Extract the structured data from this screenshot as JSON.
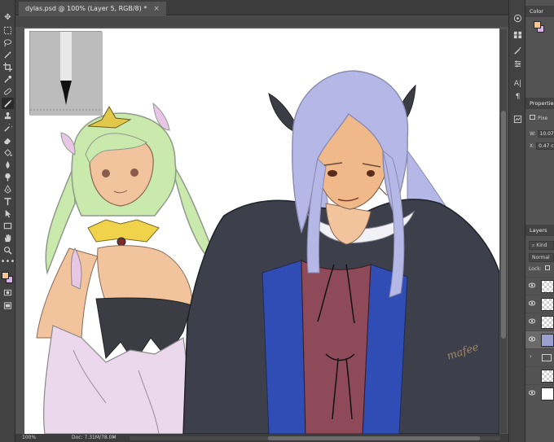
{
  "document": {
    "tab_title": "dylas.psd @ 100% (Layer 5, RGB/8) *",
    "close_label": "×"
  },
  "status": {
    "zoom": "100%",
    "doc_size": "Doc: 7.31M/78.0M",
    "arrow": "›"
  },
  "artwork": {
    "signature": "mafee"
  },
  "panels": {
    "color_tab": "Color",
    "properties_tab": "Properties",
    "properties_kind": "Pixe",
    "width_label": "W:",
    "width_value": "10.07",
    "x_label": "X:",
    "x_value": "0.47 c",
    "layers_tab": "Layers",
    "kind_filter": "Kind",
    "blend_mode": "Normal",
    "lock_label": "Lock:"
  },
  "colors": {
    "foreground": "#f8c592",
    "background": "#d6b4e6",
    "ui_dark": "#424242",
    "ui_mid": "#535353"
  },
  "icons": {
    "toolbar": [
      "move-icon",
      "marquee-icon",
      "lasso-icon",
      "magic-wand-icon",
      "crop-icon",
      "eyedropper-icon",
      "healing-icon",
      "brush-icon",
      "stamp-icon",
      "history-brush-icon",
      "eraser-icon",
      "paint-bucket-icon",
      "blur-icon",
      "dodge-icon",
      "pen-icon",
      "type-icon",
      "path-select-icon",
      "shape-icon",
      "hand-icon",
      "zoom-icon",
      "more-tools-icon"
    ],
    "strip": [
      "color-panel-icon",
      "swatches-icon",
      "brushes-icon",
      "adjust-icon",
      "character-icon",
      "paragraph-icon",
      "properties-icon"
    ]
  }
}
